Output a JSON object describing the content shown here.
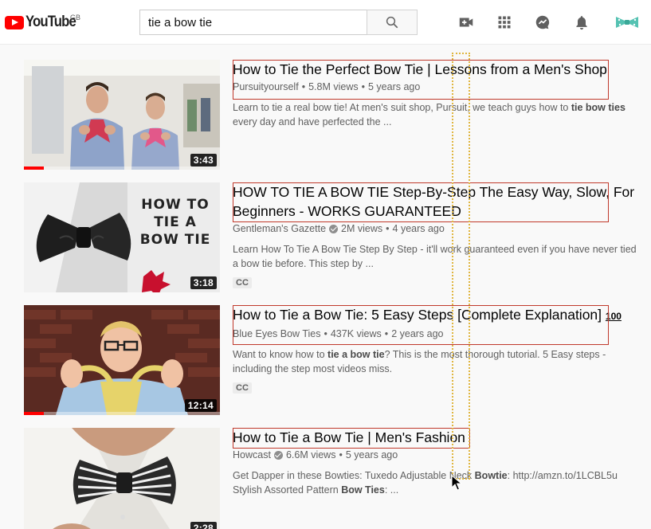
{
  "masthead": {
    "logo_text": "YouTube",
    "region": "GB",
    "search_value": "tie a bow tie",
    "search_placeholder": "Search",
    "icons": [
      "create-video-icon",
      "apps-grid-icon",
      "messages-icon",
      "notifications-bell-icon",
      "account-avatar-icon"
    ]
  },
  "results": [
    {
      "title": "How to Tie the Perfect Bow Tie | Lessons from a Men's Shop",
      "channel": "Pursuityourself",
      "verified": false,
      "views": "5.8M views",
      "age": "5 years ago",
      "desc_parts": [
        "Learn to tie a real bow tie! At men's suit shop, Pursuit, we teach guys how to ",
        "tie bow ties",
        " every day and have perfected the ..."
      ],
      "duration": "3:43",
      "badge": "",
      "watched_fraction": 0.1
    },
    {
      "title": "HOW TO TIE A BOW TIE Step-By-Step The Easy Way, Slow, For Beginners - WORKS GUARANTEED",
      "channel": "Gentleman's Gazette",
      "verified": true,
      "views": "2M views",
      "age": "4 years ago",
      "desc_parts": [
        "Learn How To Tie A Bow Tie Step By Step - it'll work guaranteed even if you have never tied a bow tie before. This step by ...",
        "",
        ""
      ],
      "duration": "3:18",
      "badge": "CC",
      "thumb_text": [
        "HOW TO",
        "TIE A",
        "BOW TIE"
      ],
      "watched_fraction": 0
    },
    {
      "title": "How to Tie a Bow Tie: 5 Easy Steps [Complete Explanation]",
      "title_suffix": "100",
      "channel": "Blue Eyes Bow Ties",
      "verified": false,
      "views": "437K views",
      "age": "2 years ago",
      "desc_parts": [
        "Want to know how to ",
        "tie a bow tie",
        "? This is the most thorough tutorial. 5 Easy steps - including the step most videos miss."
      ],
      "duration": "12:14",
      "badge": "CC",
      "watched_fraction": 0.1
    },
    {
      "title": "How to Tie a Bow Tie | Men's Fashion",
      "channel": "Howcast",
      "verified": true,
      "views": "6.6M views",
      "age": "5 years ago",
      "desc_parts": [
        "Get Dapper in these Bowties: Tuxedo Adjustable Neck ",
        "Bowtie",
        ": http://amzn.to/1LCBL5u Stylish Assorted Pattern ",
        "Bow Ties",
        ": ..."
      ],
      "duration": "2:28",
      "badge": "",
      "watched_fraction": 0
    }
  ]
}
